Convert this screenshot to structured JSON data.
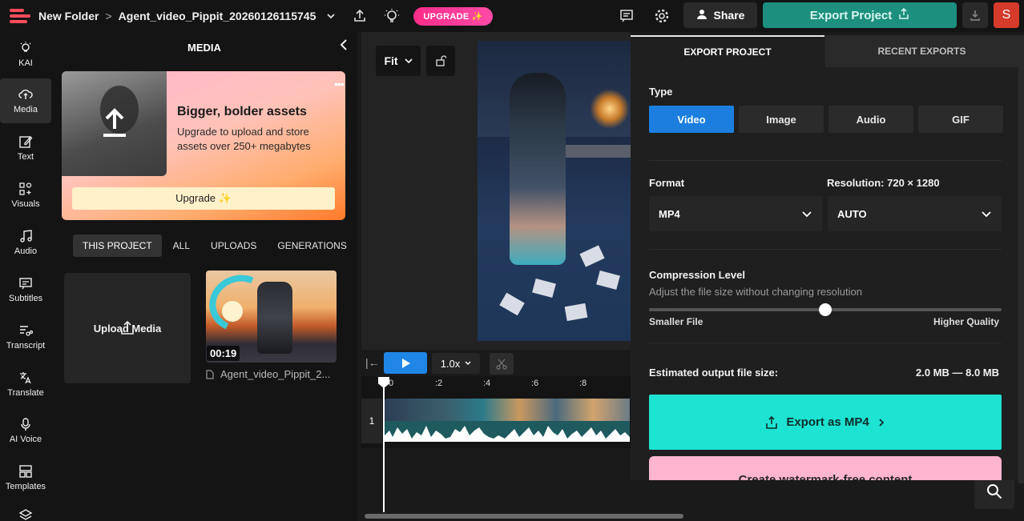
{
  "topbar": {
    "folder": "New Folder",
    "separator": ">",
    "project_name": "Agent_video_Pippit_20260126115745",
    "upgrade_label": "UPGRADE",
    "share_label": "Share",
    "export_label": "Export Project",
    "avatar_letter": "S"
  },
  "nav": [
    {
      "label": "KAI"
    },
    {
      "label": "Media"
    },
    {
      "label": "Text"
    },
    {
      "label": "Visuals"
    },
    {
      "label": "Audio"
    },
    {
      "label": "Subtitles"
    },
    {
      "label": "Transcript"
    },
    {
      "label": "Translate"
    },
    {
      "label": "AI Voice"
    },
    {
      "label": "Templates"
    }
  ],
  "media": {
    "title": "MEDIA",
    "promo_title": "Bigger, bolder assets",
    "promo_text": "Upgrade to upload and store assets over 250+ megabytes",
    "promo_button": "Upgrade ✨",
    "tabs": [
      "THIS PROJECT",
      "ALL",
      "UPLOADS",
      "GENERATIONS"
    ],
    "upload_label": "Upload Media",
    "clip_duration": "00:19",
    "clip_name": "Agent_video_Pippit_2..."
  },
  "canvas": {
    "fit_label": "Fit"
  },
  "timeline": {
    "speed": "1.0x",
    "ticks": [
      "0",
      ":2",
      ":4",
      ":6",
      ":8"
    ],
    "track_number": "1"
  },
  "export": {
    "tab_active": "EXPORT PROJECT",
    "tab_other": "RECENT EXPORTS",
    "type_label": "Type",
    "types": [
      "Video",
      "Image",
      "Audio",
      "GIF"
    ],
    "format_label": "Format",
    "format_value": "MP4",
    "resolution_label": "Resolution:",
    "resolution_value": "720 × 1280",
    "resolution_select": "AUTO",
    "compression_label": "Compression Level",
    "compression_sub": "Adjust the file size without changing resolution",
    "compression_value": 0.5,
    "smaller_label": "Smaller File",
    "higher_label": "Higher Quality",
    "estimated_label": "Estimated output file size:",
    "estimated_value": "2.0 MB — 8.0 MB",
    "export_button": "Export as MP4",
    "watermark_button": "Create watermark-free content"
  },
  "colors": {
    "accent_export": "#1de3d2",
    "accent_blue": "#1c7fe0",
    "upgrade_pink": "#ff2d8a"
  }
}
